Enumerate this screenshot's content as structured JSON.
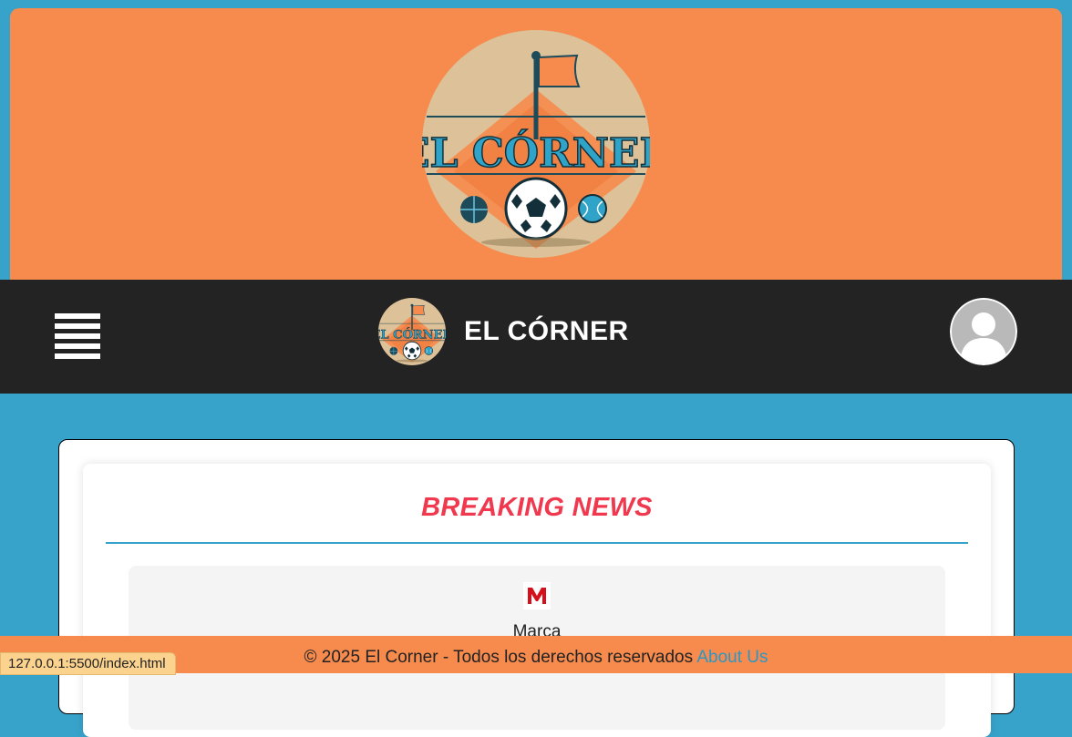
{
  "banner": {
    "logo_icon": "el-corner-logo"
  },
  "navbar": {
    "menu_icon": "hamburger-menu-icon",
    "brand_title": "EL CÓRNER",
    "avatar_icon": "user-avatar-icon"
  },
  "news": {
    "heading": "BREAKING NEWS",
    "sources": [
      {
        "name": "Marca",
        "icon": "marca-logo-icon"
      }
    ]
  },
  "footer": {
    "copyright": "© 2025 El Corner - Todos los derechos reservados ",
    "about_link": "About Us"
  },
  "status_bar": {
    "url": "127.0.0.1:5500/index.html"
  },
  "colors": {
    "page_bg": "#38a3ca",
    "accent_orange": "#f68b4d",
    "navbar_bg": "#232323",
    "headline_red": "#f0384e"
  }
}
